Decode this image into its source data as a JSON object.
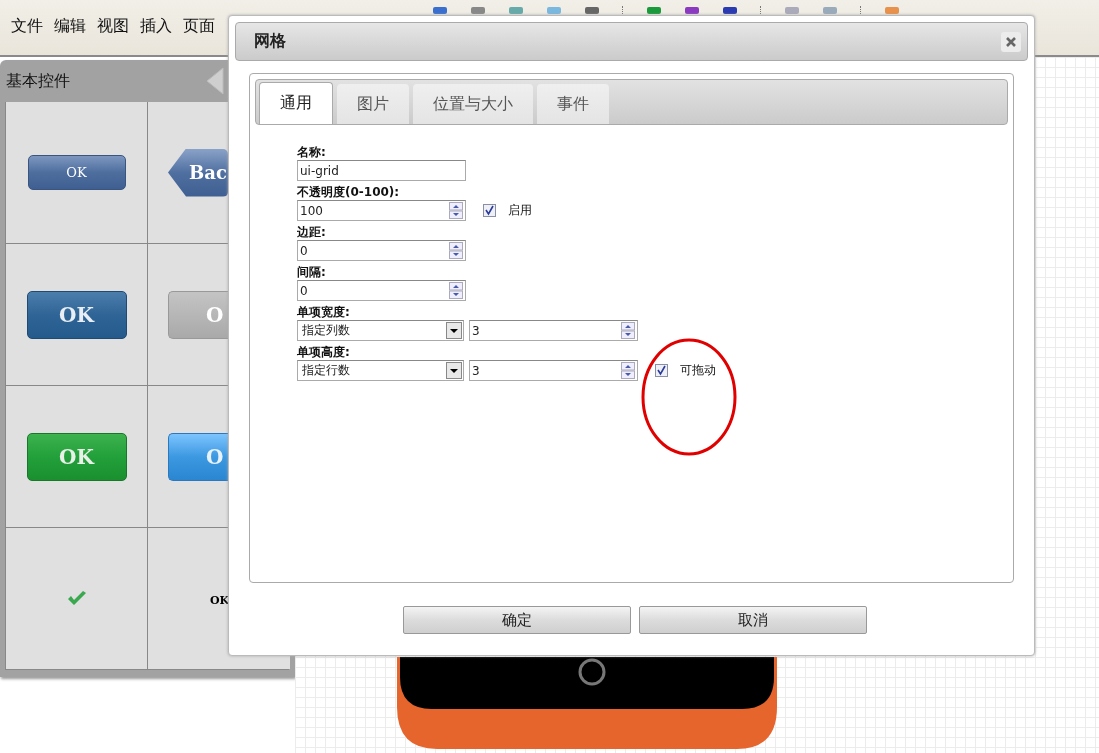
{
  "menu_bar": {
    "items": [
      "文件",
      "编辑",
      "视图",
      "插入",
      "页面"
    ]
  },
  "palette": {
    "title": "基本控件",
    "cells": [
      {
        "kind": "small-button",
        "label": "OK"
      },
      {
        "kind": "back-button",
        "label": "Bac"
      },
      {
        "kind": "dark-button",
        "label": "OK"
      },
      {
        "kind": "disabled-button",
        "label": "O"
      },
      {
        "kind": "green-button",
        "label": "OK"
      },
      {
        "kind": "light-button",
        "label": "O"
      },
      {
        "kind": "check"
      },
      {
        "kind": "text",
        "label": "OK"
      }
    ]
  },
  "dialog": {
    "title": "网格",
    "tabs": [
      {
        "label": "通用",
        "selected": true
      },
      {
        "label": "图片",
        "selected": false
      },
      {
        "label": "位置与大小",
        "selected": false
      },
      {
        "label": "事件",
        "selected": false
      }
    ],
    "form": [
      {
        "label": "名称:",
        "kind": "text",
        "value": "ui-grid"
      },
      {
        "label": "不透明度(0-100):",
        "kind": "spinner",
        "value": "100",
        "checkbox": {
          "label": "启用",
          "checked": true
        }
      },
      {
        "label": "边距:",
        "kind": "spinner",
        "value": "0"
      },
      {
        "label": "间隔:",
        "kind": "spinner",
        "value": "0"
      },
      {
        "label": "单项宽度:",
        "kind": "select-spinner",
        "option": "指定列数",
        "value": "3"
      },
      {
        "label": "单项高度:",
        "kind": "select-spinner",
        "option": "指定行数",
        "value": "3",
        "checkbox": {
          "label": "可拖动",
          "checked": true
        }
      }
    ],
    "buttons": [
      "确定",
      "取消"
    ]
  }
}
